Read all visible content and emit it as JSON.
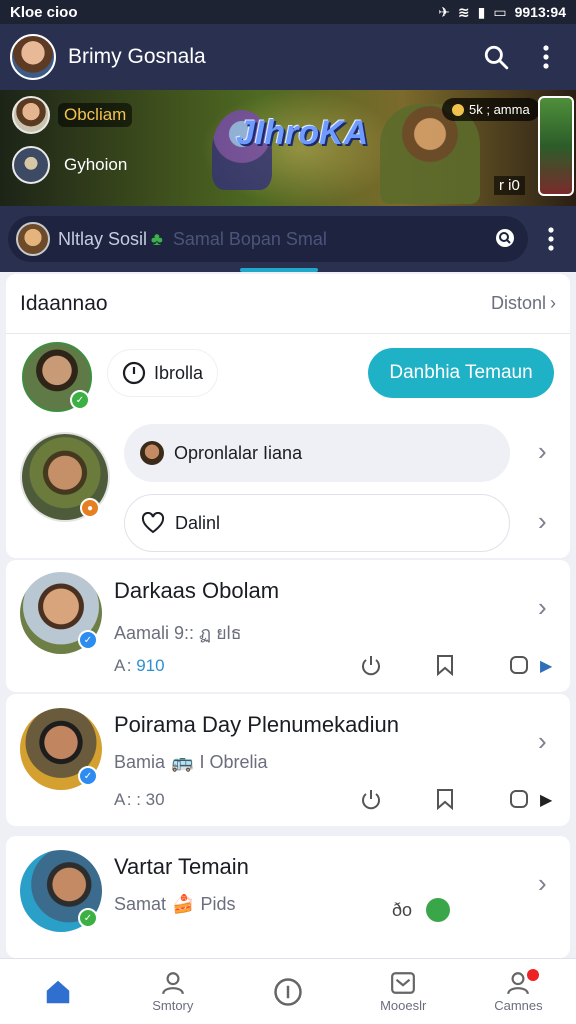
{
  "status_bar": {
    "left": "Kloe cioo",
    "time": "9913:94"
  },
  "header": {
    "name": "Brimy Gosnala"
  },
  "banner": {
    "game_title": "JIhroKA",
    "row1_label": "Obcliam",
    "row2_label": "Gyhoion",
    "players": "5k ; amma",
    "count": "r i0"
  },
  "search": {
    "text": "Nltlay Sosil",
    "placeholder": "Samal Bopan Smal"
  },
  "top_card": {
    "title": "Idaannao",
    "link": "Distonl",
    "pill_label": "Ibrolla",
    "cta": "Danbhia Temaun",
    "field1": "Opronlalar Iiana",
    "field2": "Dalinl"
  },
  "items": [
    {
      "title": "Darkaas Obolam",
      "sub": "Aamali 9:: ฏ ยlธ",
      "meta_a": "A : ",
      "meta_b": "910"
    },
    {
      "title": "Poirama Day Plenumekadiun",
      "sub": "Bamia",
      "sub2": "I Obrelia",
      "meta_a": "A : : 30",
      "meta_b": ""
    },
    {
      "title": "Vartar Temain",
      "sub": "Samat",
      "sub2": "Pids",
      "extra": "ðo"
    }
  ],
  "bottom_nav": {
    "item2": "Smtory",
    "item4": "Mooeslr",
    "item5": "Camnes"
  },
  "colors": {
    "accent": "#1fb1c6",
    "header_bg": "#2a3050"
  }
}
